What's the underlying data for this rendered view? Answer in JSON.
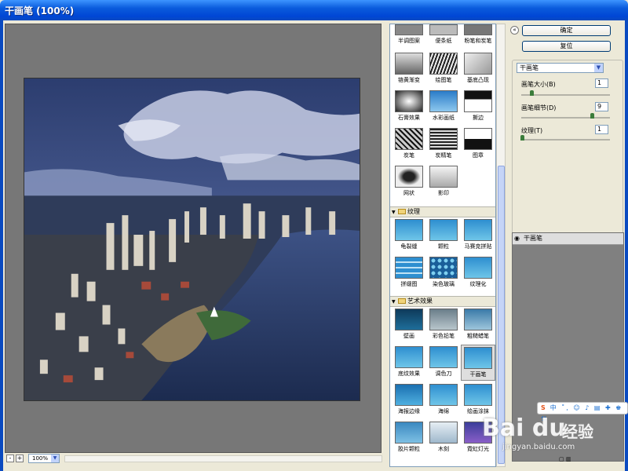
{
  "window": {
    "title": "干画笔 (100%)"
  },
  "status": {
    "zoom": "100%",
    "zoom_out": "-",
    "zoom_in": "+"
  },
  "gallery": {
    "row1": [
      "半调图案",
      "便条纸",
      "粉笔和炭笔"
    ],
    "row2": [
      "铬黄渐变",
      "绘图笔",
      "基底凸现"
    ],
    "row3": [
      "石膏效果",
      "水彩画纸",
      "撕边"
    ],
    "row4": [
      "炭笔",
      "炭精笔",
      "图章"
    ],
    "row5": [
      "网状",
      "影印"
    ],
    "cat_texture": "纹理",
    "texture": [
      "龟裂缝",
      "颗粒",
      "马赛克拼贴",
      "拼缀图",
      "染色玻璃",
      "纹理化"
    ],
    "cat_art": "艺术效果",
    "art": [
      "壁画",
      "彩色铅笔",
      "粗糙蜡笔",
      "底纹效果",
      "调色刀",
      "干画笔",
      "海报边缘",
      "海绵",
      "绘画涂抹",
      "胶片颗粒",
      "木刻",
      "霓虹灯光"
    ]
  },
  "panel": {
    "ok": "确定",
    "reset": "复位",
    "filter": "干画笔",
    "params": [
      {
        "label": "画笔大小(B)",
        "value": "1"
      },
      {
        "label": "画笔细节(D)",
        "value": "9"
      },
      {
        "label": "纹理(T)",
        "value": "1"
      }
    ],
    "layer": "干画笔"
  },
  "watermark": {
    "logo": "Bai du",
    "cn": "经验",
    "url": "jingyan.baidu.com"
  },
  "ime": {
    "brand": "S",
    "items": "中 ˚, ☺ ♪ ▤ ✚ ♚ ⚒"
  }
}
